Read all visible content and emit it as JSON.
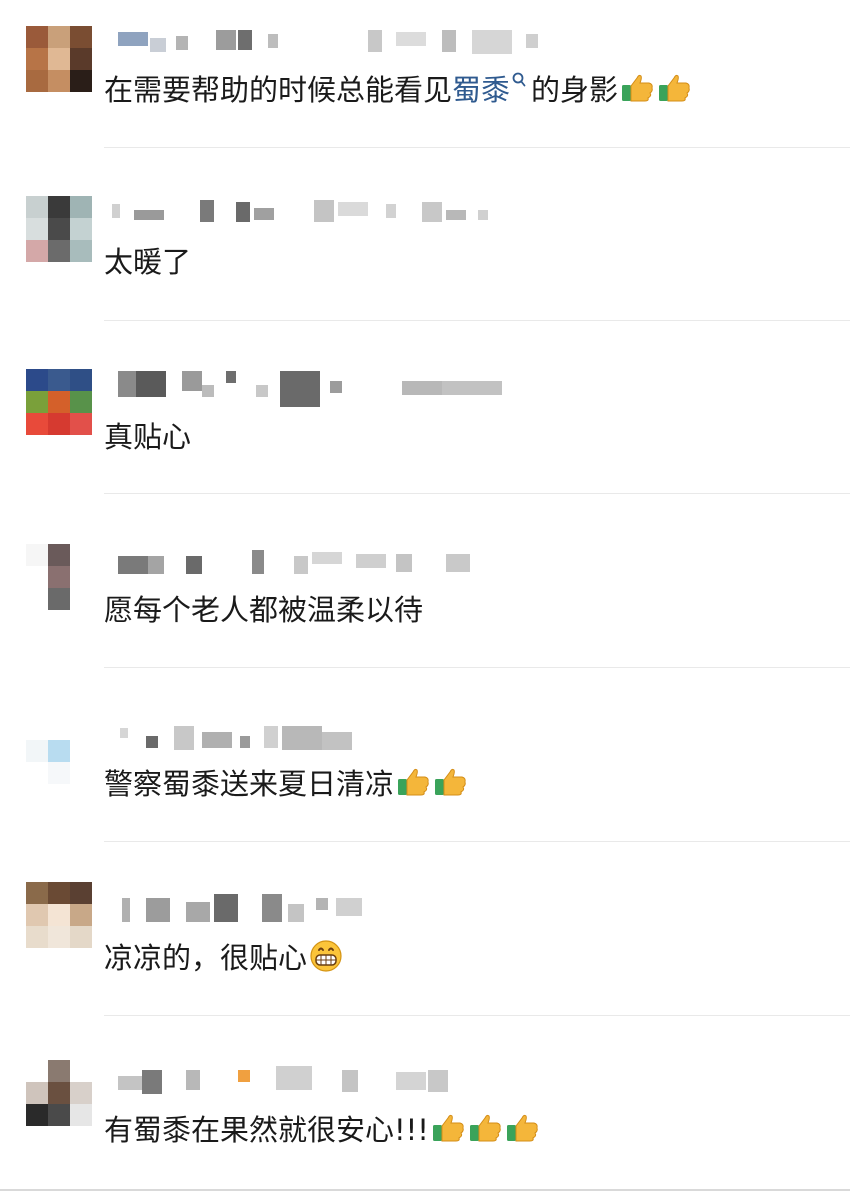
{
  "comments": [
    {
      "segments": [
        {
          "text": "在需要帮助的时候总能看见"
        },
        {
          "text": "蜀黍",
          "link": true
        },
        {
          "text": "的身影"
        }
      ],
      "emojis": [
        "thumbs-up",
        "thumbs-up"
      ]
    },
    {
      "segments": [
        {
          "text": "太暖了"
        }
      ],
      "emojis": []
    },
    {
      "segments": [
        {
          "text": "真贴心"
        }
      ],
      "emojis": []
    },
    {
      "segments": [
        {
          "text": "愿每个老人都被温柔以待"
        }
      ],
      "emojis": []
    },
    {
      "segments": [
        {
          "text": "警察蜀黍送来夏日清凉"
        }
      ],
      "emojis": [
        "thumbs-up",
        "thumbs-up"
      ]
    },
    {
      "segments": [
        {
          "text": "凉凉的，很贴心"
        }
      ],
      "emojis": [
        "grinning-face"
      ]
    },
    {
      "segments": [
        {
          "text": "有蜀黍在果然就很安心!!!"
        }
      ],
      "emojis": [
        "thumbs-up",
        "thumbs-up",
        "thumbs-up"
      ]
    }
  ],
  "colors": {
    "link": "#2f5a8f",
    "text": "#1a1a1a",
    "divider": "#e9e9e9",
    "thumb": "#f4b63a",
    "cuff": "#3aa35a"
  }
}
